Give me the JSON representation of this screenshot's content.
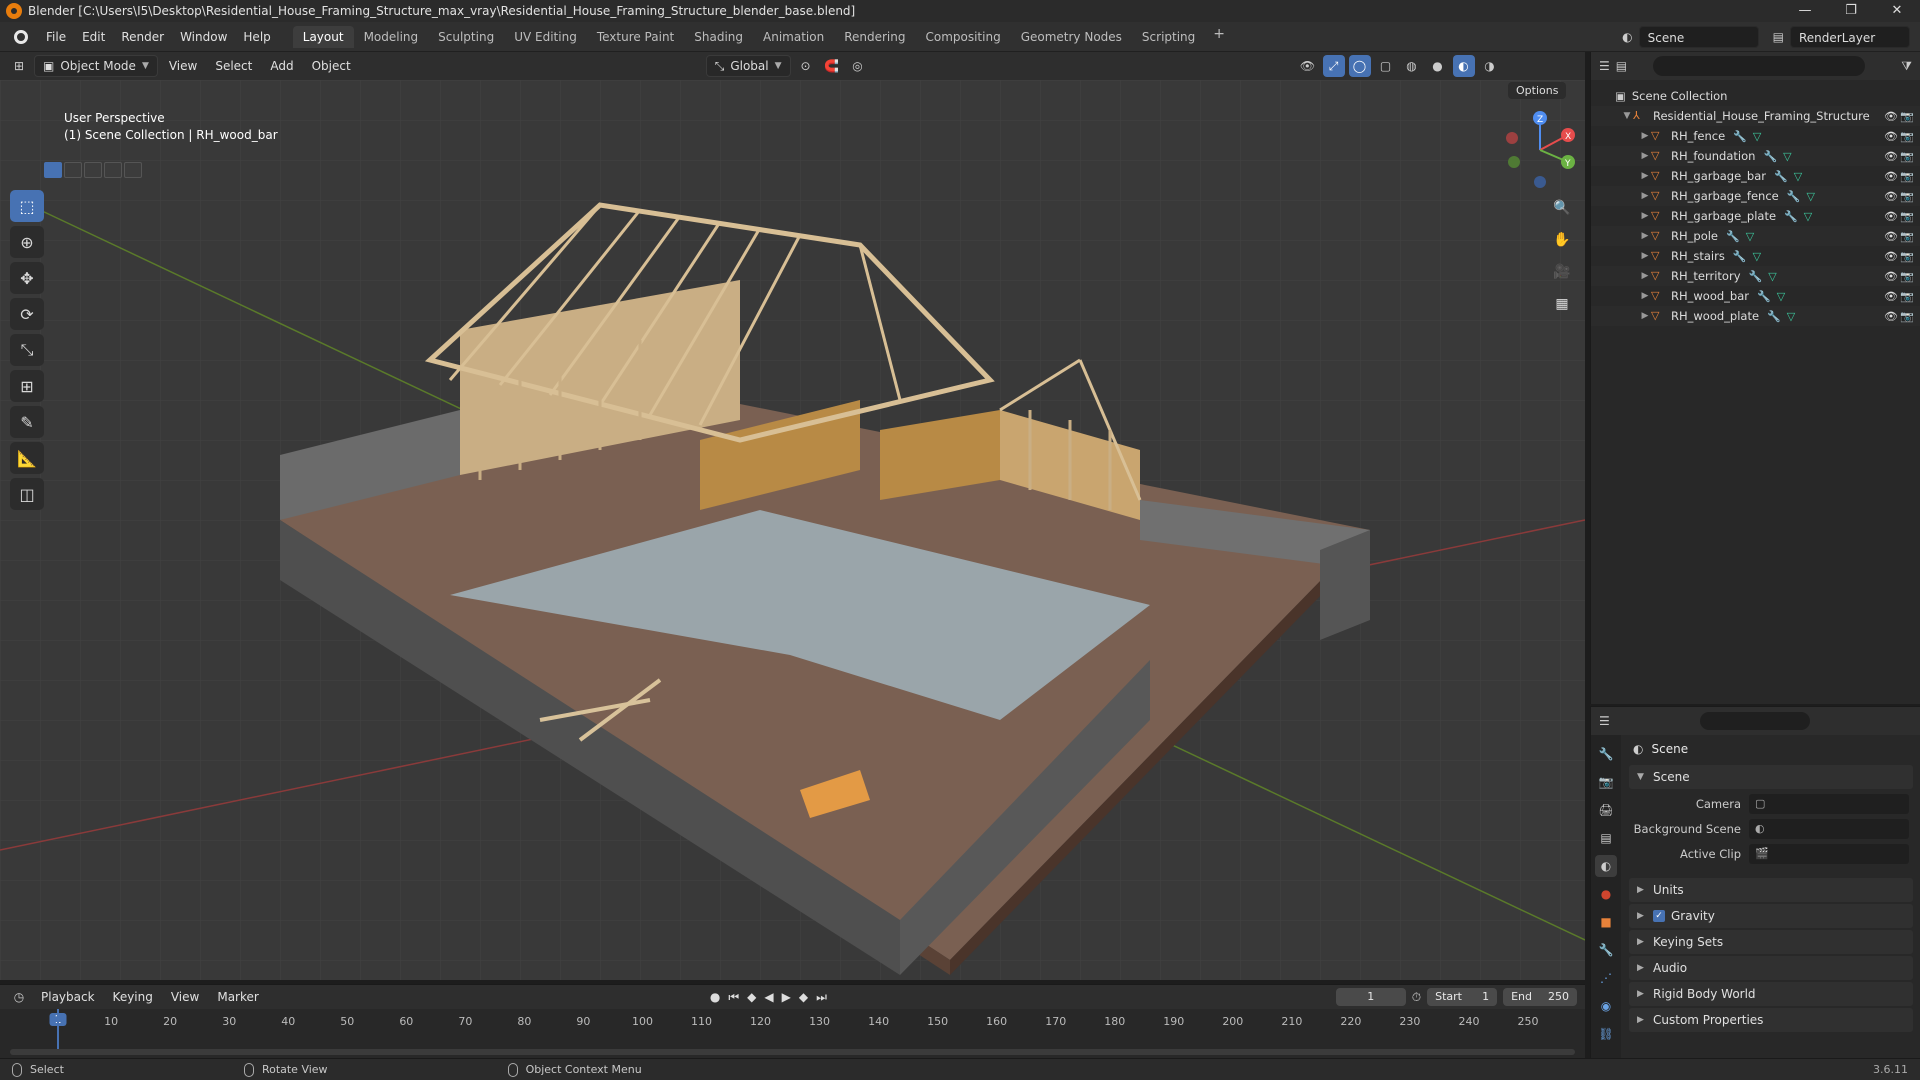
{
  "window": {
    "title": "Blender [C:\\Users\\I5\\Desktop\\Residential_House_Framing_Structure_max_vray\\Residential_House_Framing_Structure_blender_base.blend]",
    "controls": [
      "—",
      "❐",
      "✕"
    ]
  },
  "menubar": {
    "items": [
      "File",
      "Edit",
      "Render",
      "Window",
      "Help"
    ],
    "workspaces": [
      "Layout",
      "Modeling",
      "Sculpting",
      "UV Editing",
      "Texture Paint",
      "Shading",
      "Animation",
      "Rendering",
      "Compositing",
      "Geometry Nodes",
      "Scripting"
    ],
    "active_workspace": "Layout",
    "scene": "Scene",
    "render_layer": "RenderLayer"
  },
  "viewport_header": {
    "mode": "Object Mode",
    "menus": [
      "View",
      "Select",
      "Add",
      "Object"
    ],
    "orientation": "Global",
    "options": "Options"
  },
  "viewport": {
    "perspective": "User Perspective",
    "context": "(1) Scene Collection | RH_wood_bar"
  },
  "outliner": {
    "root": "Scene Collection",
    "collection": "Residential_House_Framing_Structure",
    "objects": [
      "RH_fence",
      "RH_foundation",
      "RH_garbage_bar",
      "RH_garbage_fence",
      "RH_garbage_plate",
      "RH_pole",
      "RH_stairs",
      "RH_territory",
      "RH_wood_bar",
      "RH_wood_plate"
    ]
  },
  "properties": {
    "context_title": "Scene",
    "panel_scene": "Scene",
    "camera_label": "Camera",
    "background_scene_label": "Background Scene",
    "active_clip_label": "Active Clip",
    "panels": [
      "Units",
      "Gravity",
      "Keying Sets",
      "Audio",
      "Rigid Body World",
      "Custom Properties"
    ]
  },
  "timeline": {
    "menus": [
      "Playback",
      "Keying",
      "View",
      "Marker"
    ],
    "current_frame": "1",
    "start_label": "Start",
    "start": "1",
    "end_label": "End",
    "end": "250",
    "ruler": [
      "1",
      "10",
      "20",
      "30",
      "40",
      "50",
      "60",
      "70",
      "80",
      "90",
      "100",
      "110",
      "120",
      "130",
      "140",
      "150",
      "160",
      "170",
      "180",
      "190",
      "200",
      "210",
      "220",
      "230",
      "240",
      "250"
    ]
  },
  "statusbar": {
    "select": "Select",
    "rotate": "Rotate View",
    "context_menu": "Object Context Menu",
    "version": "3.6.11"
  },
  "colors": {
    "accent": "#4772b3",
    "object_icon": "#e8823a",
    "mesh_icon": "#3cc79d"
  }
}
